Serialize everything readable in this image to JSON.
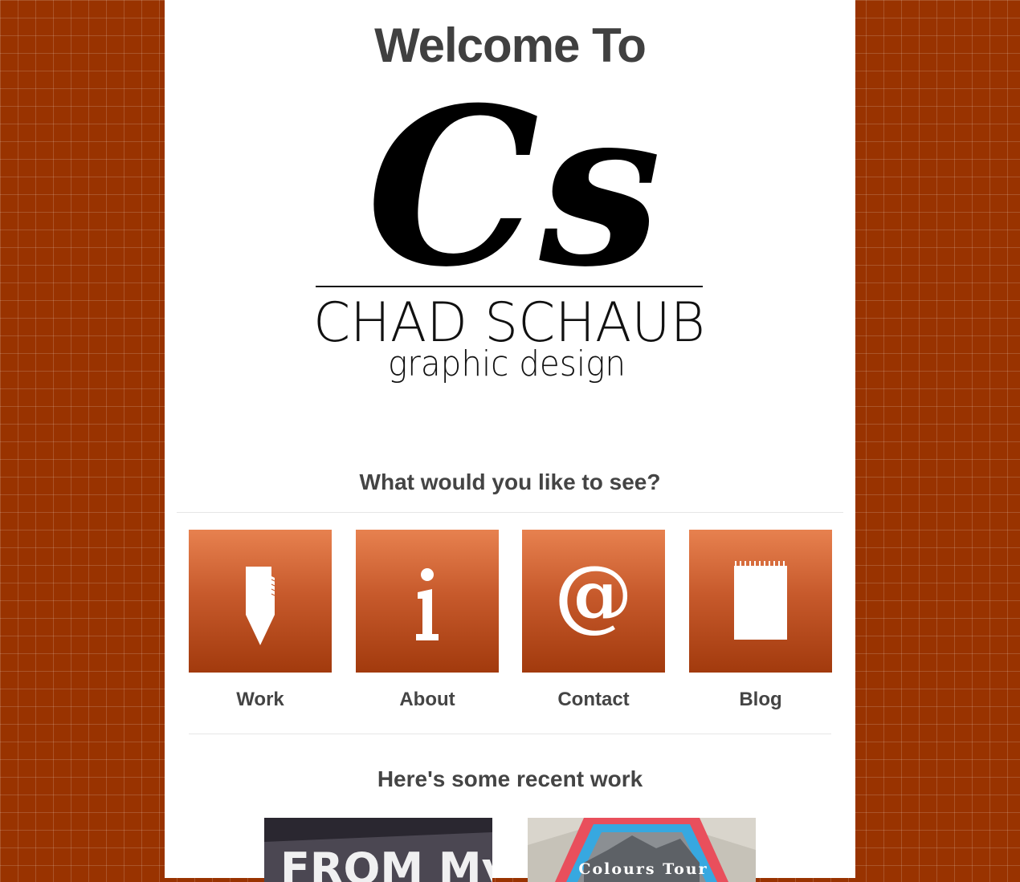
{
  "header": {
    "title": "Welcome To"
  },
  "logo": {
    "monogram": "Cs",
    "name": "CHAD SCHAUB",
    "tagline": "graphic design"
  },
  "nav": {
    "heading": "What would you like to see?",
    "items": [
      {
        "label": "Work",
        "icon": "pen-nib-icon"
      },
      {
        "label": "About",
        "icon": "info-icon"
      },
      {
        "label": "Contact",
        "icon": "at-sign-icon"
      },
      {
        "label": "Blog",
        "icon": "notepad-icon"
      }
    ]
  },
  "recent": {
    "heading": "Here's some recent work",
    "items": [
      {
        "title": "FROM My"
      },
      {
        "title": "Colours Tour"
      }
    ]
  },
  "colors": {
    "background": "#993300",
    "tile_top": "#e7814f",
    "tile_bottom": "#a23a0d",
    "text": "#444444"
  }
}
